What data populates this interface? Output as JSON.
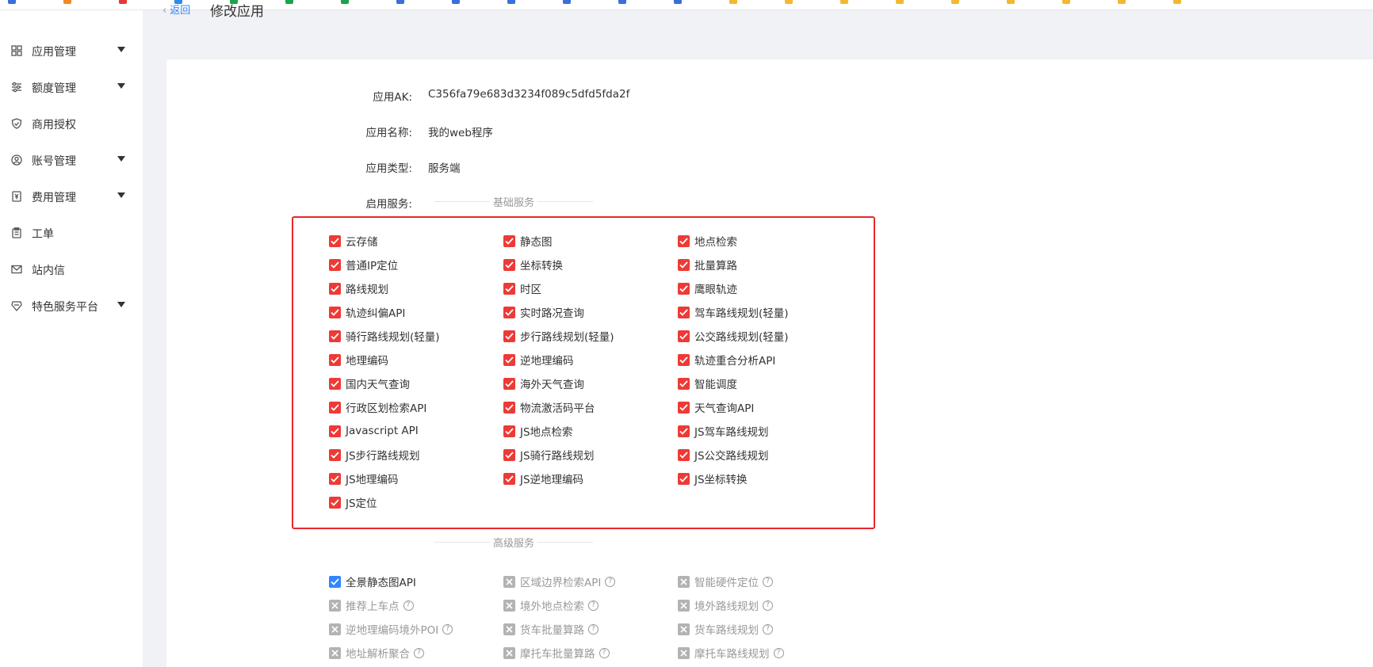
{
  "colors": {
    "checked_red": "#ee3a36",
    "checked_blue": "#3385ff",
    "disabled_gray": "#b3b3b3",
    "highlight_border": "#e8262c",
    "link_blue": "#3385ff"
  },
  "sidebar": {
    "items": [
      {
        "label": "应用管理",
        "icon": "grid-icon",
        "caret": true
      },
      {
        "label": "额度管理",
        "icon": "sliders-icon",
        "caret": true
      },
      {
        "label": "商用授权",
        "icon": "shield-check-icon",
        "caret": false
      },
      {
        "label": "账号管理",
        "icon": "user-circle-icon",
        "caret": true
      },
      {
        "label": "费用管理",
        "icon": "yen-doc-icon",
        "caret": true
      },
      {
        "label": "工单",
        "icon": "clipboard-icon",
        "caret": false
      },
      {
        "label": "站内信",
        "icon": "mail-icon",
        "caret": false
      },
      {
        "label": "特色服务平台",
        "icon": "diamond-icon",
        "caret": true
      }
    ]
  },
  "header": {
    "back_label": "返回",
    "title": "修改应用"
  },
  "info": {
    "ak_label": "应用AK:",
    "ak_value": "C356fa79e683d3234f089c5dfd5fda2f",
    "name_label": "应用名称:",
    "name_value": "我的web程序",
    "type_label": "应用类型:",
    "type_value": "服务端",
    "services_label": "启用服务:"
  },
  "basic_section": {
    "title": "基础服务",
    "services": [
      [
        "云存储",
        "静态图",
        "地点检索"
      ],
      [
        "普通IP定位",
        "坐标转换",
        "批量算路"
      ],
      [
        "路线规划",
        "时区",
        "鹰眼轨迹"
      ],
      [
        "轨迹纠偏API",
        "实时路况查询",
        "驾车路线规划(轻量)"
      ],
      [
        "骑行路线规划(轻量)",
        "步行路线规划(轻量)",
        "公交路线规划(轻量)"
      ],
      [
        "地理编码",
        "逆地理编码",
        "轨迹重合分析API"
      ],
      [
        "国内天气查询",
        "海外天气查询",
        "智能调度"
      ],
      [
        "行政区划检索API",
        "物流激活码平台",
        "天气查询API"
      ],
      [
        "Javascript API",
        "JS地点检索",
        "JS驾车路线规划"
      ],
      [
        "JS步行路线规划",
        "JS骑行路线规划",
        "JS公交路线规划"
      ],
      [
        "JS地理编码",
        "JS逆地理编码",
        "JS坐标转换"
      ],
      [
        "JS定位"
      ]
    ]
  },
  "advanced_section": {
    "title": "高级服务",
    "services": [
      [
        {
          "label": "全景静态图API",
          "state": "checked"
        },
        {
          "label": "区域边界检索API",
          "state": "disabled"
        },
        {
          "label": "智能硬件定位",
          "state": "disabled"
        }
      ],
      [
        {
          "label": "推荐上车点",
          "state": "disabled"
        },
        {
          "label": "境外地点检索",
          "state": "disabled"
        },
        {
          "label": "境外路线规划",
          "state": "disabled"
        }
      ],
      [
        {
          "label": "逆地理编码境外POI",
          "state": "disabled"
        },
        {
          "label": "货车批量算路",
          "state": "disabled"
        },
        {
          "label": "货车路线规划",
          "state": "disabled"
        }
      ],
      [
        {
          "label": "地址解析聚合",
          "state": "disabled"
        },
        {
          "label": "摩托车批量算路",
          "state": "disabled"
        },
        {
          "label": "摩托车路线规划",
          "state": "disabled"
        }
      ]
    ],
    "help_glyph": "?"
  }
}
